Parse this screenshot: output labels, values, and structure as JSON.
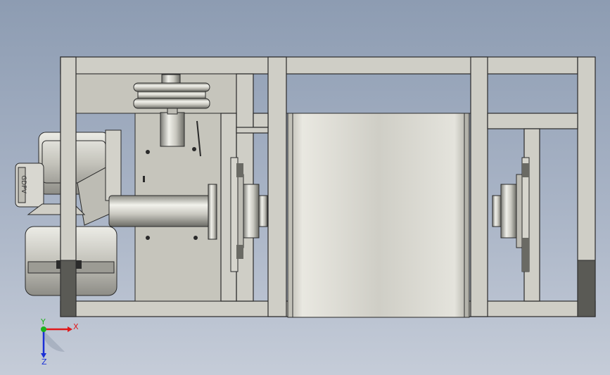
{
  "colors": {
    "background_top": "#8d9cb2",
    "background_bottom": "#c5ccd8",
    "frame": "#cfcec6",
    "axis_x": "#e0191b",
    "axis_y": "#1bb31b",
    "axis_z": "#1a2fd6"
  },
  "triad": {
    "x_label": "X",
    "y_label": "Y",
    "z_label": "Z"
  },
  "engine": {
    "brand_label": "GDPV"
  }
}
